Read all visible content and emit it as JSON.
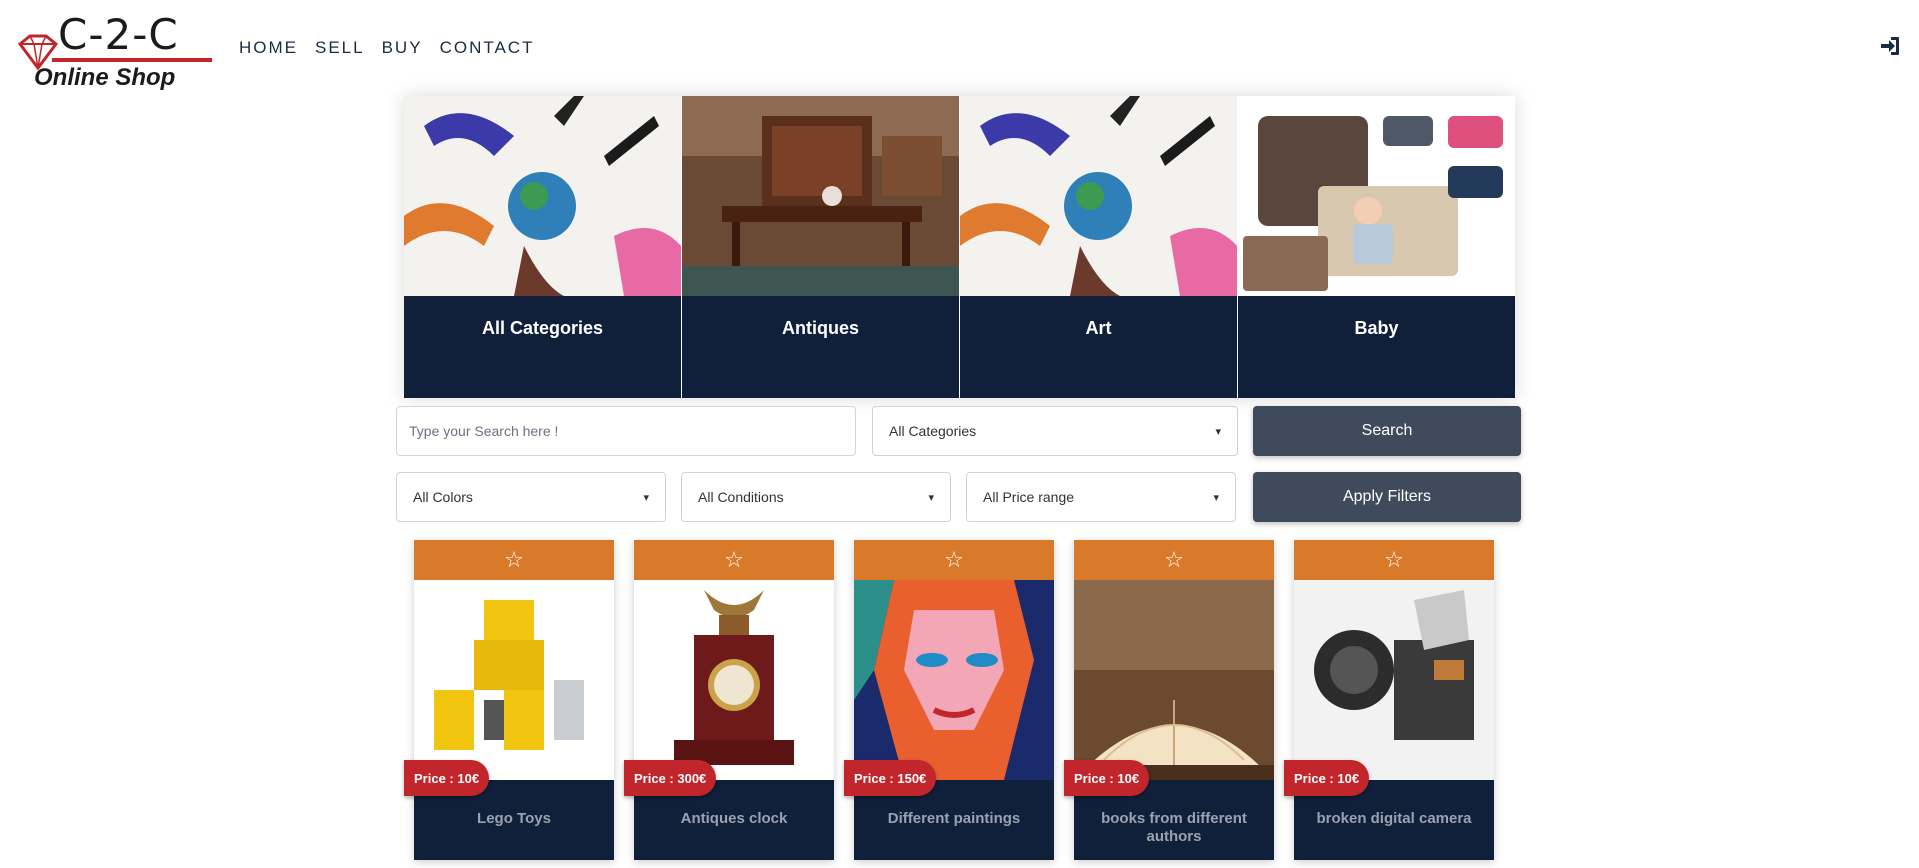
{
  "brand": {
    "logo_top": "C-2-C",
    "logo_bottom": "Online Shop"
  },
  "nav": {
    "items": [
      "HOME",
      "SELL",
      "BUY",
      "CONTACT"
    ]
  },
  "header": {
    "login_icon": "sign-in-icon"
  },
  "categories": [
    {
      "label": "All Categories"
    },
    {
      "label": "Antiques"
    },
    {
      "label": "Art"
    },
    {
      "label": "Baby"
    }
  ],
  "search": {
    "placeholder": "Type your Search here !",
    "category_selected": "All Categories",
    "button_label": "Search"
  },
  "filters": {
    "color_selected": "All Colors",
    "condition_selected": "All Conditions",
    "price_selected": "All Price range",
    "apply_label": "Apply Filters"
  },
  "products": [
    {
      "name": "Lego Toys",
      "price": "Price : 10€"
    },
    {
      "name": "Antiques clock",
      "price": "Price : 300€"
    },
    {
      "name": "Different paintings",
      "price": "Price : 150€"
    },
    {
      "name": "books from different authors",
      "price": "Price : 10€"
    },
    {
      "name": "broken digital camera",
      "price": "Price : 10€"
    }
  ],
  "colors": {
    "navy": "#10203a",
    "orange": "#d97a2b",
    "price_red": "#c1262c",
    "button": "#3f4b5d"
  }
}
